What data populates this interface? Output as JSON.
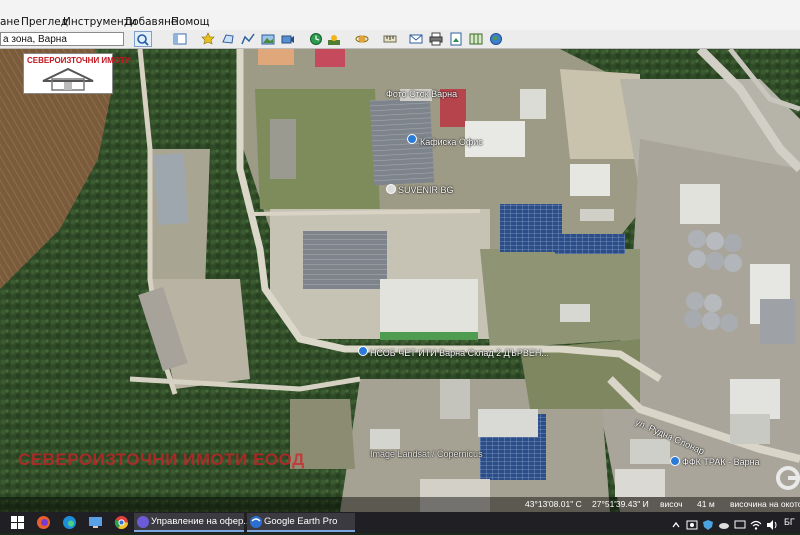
{
  "menu": {
    "items": [
      "ане",
      "Преглед",
      "Инструменти",
      "Добавяне",
      "Помощ"
    ]
  },
  "search": {
    "value": "а зона, Варна"
  },
  "logo": {
    "text": "СЕВЕРОИЗТОЧНИ ИМОТИ"
  },
  "map": {
    "labels": [
      "Фото Сток Варна",
      "Кафиска Офис",
      "SUVENIR BG",
      "НСОБ ЧЕТ ИТИ Варна Склад 2 ДЪРВЕН...",
      "Image Landsat / Copernicus",
      "ФФК ТРАК - Варна",
      "ул. Рудна Слонар"
    ],
    "watermark": "СЕВЕРОИЗТОЧНИ ИМОТИ ЕООД",
    "colors": {
      "forest": "#2f4a27",
      "field": "#7a5c3c",
      "road": "#d9d5c8",
      "roof_gray": "#8d9196",
      "roof_white": "#e6e6e2",
      "solar": "#2b4e8a",
      "pin": "#2a7bd8"
    }
  },
  "status": {
    "lat": "43°13'08.01\" С",
    "lon": "27°51'39.43\" И",
    "elev_label": "височ",
    "elev": "41 м",
    "eye": "височина на окото"
  },
  "taskbar": {
    "task1": "Управление на офер...",
    "task2": "Google Earth Pro",
    "lang": "БГ"
  }
}
